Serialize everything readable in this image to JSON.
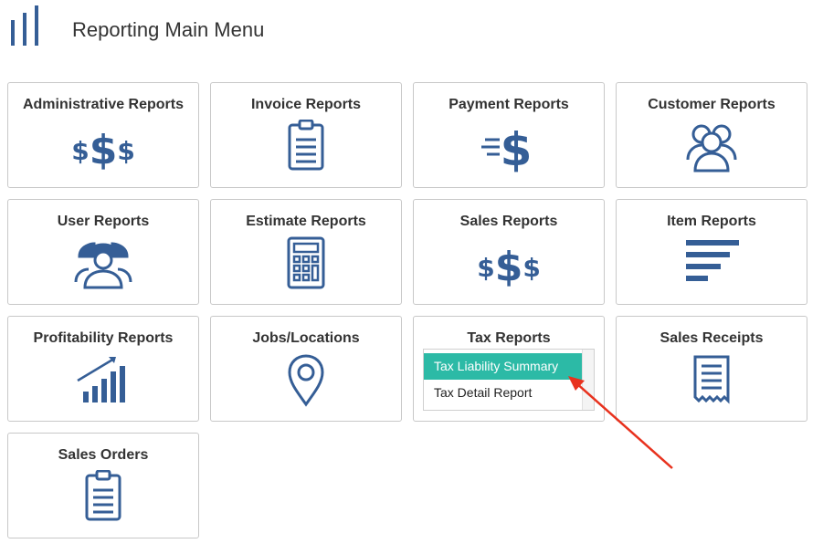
{
  "header": {
    "title": "Reporting Main Menu",
    "icon": "bar-chart-icon"
  },
  "accent_color": "#355e96",
  "highlight_color": "#2cbaa6",
  "annotation_color": "#e8321e",
  "tiles": [
    {
      "label": "Administrative Reports",
      "icon": "dollar-signs-icon"
    },
    {
      "label": "Invoice Reports",
      "icon": "clipboard-icon"
    },
    {
      "label": "Payment Reports",
      "icon": "fast-dollar-icon"
    },
    {
      "label": "Customer Reports",
      "icon": "people-group-icon"
    },
    {
      "label": "User Reports",
      "icon": "workers-icon"
    },
    {
      "label": "Estimate Reports",
      "icon": "calculator-icon"
    },
    {
      "label": "Sales Reports",
      "icon": "dollar-signs-icon"
    },
    {
      "label": "Item Reports",
      "icon": "list-lines-icon"
    },
    {
      "label": "Profitability Reports",
      "icon": "growth-chart-icon"
    },
    {
      "label": "Jobs/Locations",
      "icon": "map-pin-icon"
    },
    {
      "label": "Tax Reports",
      "icon": "dropdown-menu"
    },
    {
      "label": "Sales Receipts",
      "icon": "receipt-icon"
    },
    {
      "label": "Sales Orders",
      "icon": "clipboard-icon"
    }
  ],
  "tax_dropdown": {
    "items": [
      "Tax Liability Summary",
      "Tax Detail Report"
    ],
    "selected": "Tax Liability Summary"
  }
}
